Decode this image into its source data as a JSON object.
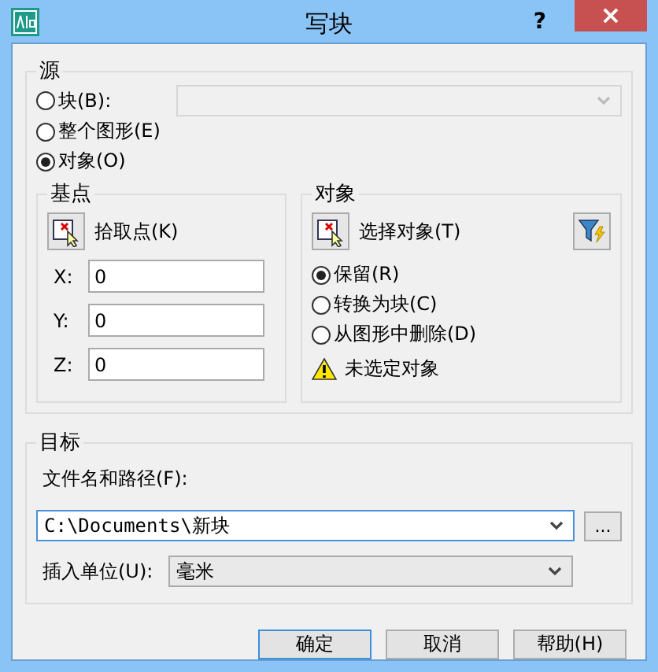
{
  "window": {
    "title": "写块",
    "help": "?",
    "close": "×"
  },
  "source": {
    "label": "源",
    "block_dropdown": {
      "disabled": true
    },
    "options": [
      {
        "label": "块(B):",
        "selected": false
      },
      {
        "label": "整个图形(E)",
        "selected": false
      },
      {
        "label": "对象(O)",
        "selected": true
      }
    ]
  },
  "base_point": {
    "label": "基点",
    "pick_button": "拾取点(K)",
    "fields": [
      {
        "label": "X:",
        "value": "0"
      },
      {
        "label": "Y:",
        "value": "0"
      },
      {
        "label": "Z:",
        "value": "0"
      }
    ]
  },
  "objects": {
    "label": "对象",
    "select_button": "选择对象(T)",
    "options": [
      {
        "label": "保留(R)",
        "selected": true
      },
      {
        "label": "转换为块(C)",
        "selected": false
      },
      {
        "label": "从图形中删除(D)",
        "selected": false
      }
    ],
    "warning": "未选定对象"
  },
  "destination": {
    "label": "目标",
    "path_label": "文件名和路径(F):",
    "path": "C:\\Documents\\新块",
    "browse": "...",
    "units_label": "插入单位(U):",
    "units": "毫米"
  },
  "buttons": [
    {
      "label": "确定",
      "default": true
    },
    {
      "label": "取消",
      "default": false
    },
    {
      "label": "帮助(H)",
      "default": false
    }
  ]
}
